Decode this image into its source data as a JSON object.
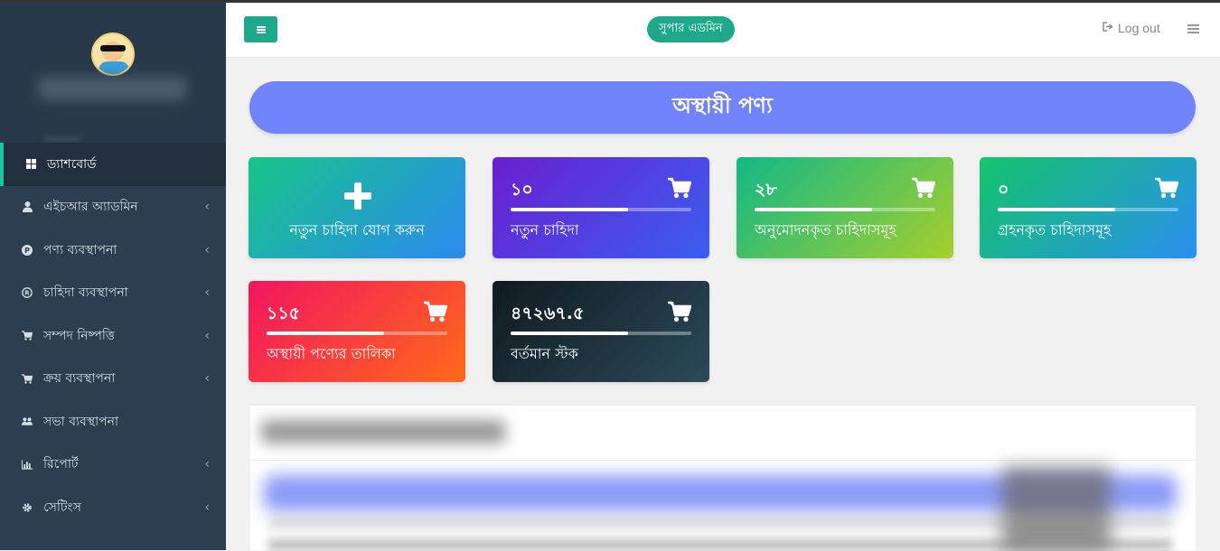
{
  "sidebar": {
    "items": [
      {
        "label": "ড্যাশবোর্ড",
        "icon": "grid-icon"
      },
      {
        "label": "এইচআর অ্যাডমিন",
        "icon": "user-icon"
      },
      {
        "label": "পণ্য ব্যবস্থাপনা",
        "icon": "p-circle-icon"
      },
      {
        "label": "চাহিদা ব্যবস্থাপনা",
        "icon": "registered-icon"
      },
      {
        "label": "সম্পদ নিষ্পত্তি",
        "icon": "cart-icon"
      },
      {
        "label": "ক্রয় ব্যবস্থাপনা",
        "icon": "cart-icon"
      },
      {
        "label": "সভা ব্যবস্থাপনা",
        "icon": "users-icon"
      },
      {
        "label": "রিপোর্ট",
        "icon": "bar-chart-icon"
      },
      {
        "label": "সেটিংস",
        "icon": "gear-icon"
      }
    ]
  },
  "header": {
    "role_badge": "সুপার এডমিন",
    "logout_label": "Log out"
  },
  "banner": {
    "title": "অস্থায়ী পণ্য"
  },
  "cards": {
    "add_label": "নতুন চাহিদা যোগ করুন",
    "new_demand": {
      "value": "১০",
      "label": "নতুন চাহিদা"
    },
    "approved": {
      "value": "২৮",
      "label": "অনুমোদনকৃত চাহিদাসমূহ"
    },
    "accepted": {
      "value": "০",
      "label": "গ্রহনকৃত চাহিদাসমূহ"
    },
    "temp_list": {
      "value": "১১৫",
      "label": "অস্থায়ী পণ্যের তালিকা"
    },
    "stock": {
      "value": "৪৭২৬৭.৫",
      "label": "বর্তমান স্টক"
    }
  },
  "colors": {
    "accent": "#1fa98b",
    "sidebar": "#2c3e50",
    "banner": "#7184fb"
  }
}
